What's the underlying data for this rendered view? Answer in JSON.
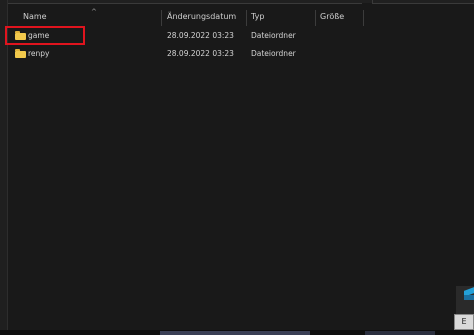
{
  "columns": {
    "name": "Name",
    "date": "Änderungsdatum",
    "type": "Typ",
    "size": "Größe"
  },
  "rows": [
    {
      "name": "game",
      "date": "28.09.2022 03:23",
      "type": "Dateiordner",
      "icon": "folder-icon"
    },
    {
      "name": "renpy",
      "date": "28.09.2022 03:23",
      "type": "Dateiordner",
      "icon": "folder-icon"
    }
  ],
  "sort_indicator": "^",
  "corner_tile_label": "E",
  "colors": {
    "background": "#191919",
    "folder": "#f2c94c",
    "highlight": "#e0141e"
  }
}
